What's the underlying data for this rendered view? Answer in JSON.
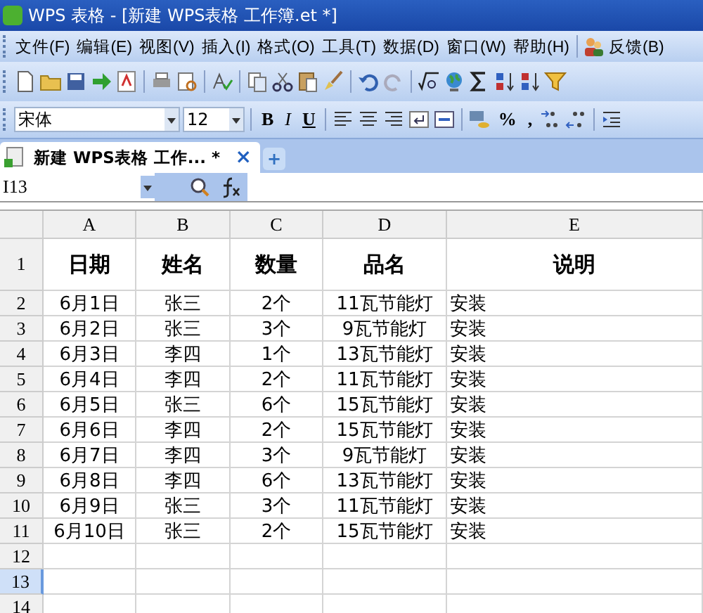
{
  "window": {
    "title": "WPS 表格 - [新建 WPS表格 工作簿.et *]"
  },
  "menu": [
    "文件(F)",
    "编辑(E)",
    "视图(V)",
    "插入(I)",
    "格式(O)",
    "工具(T)",
    "数据(D)",
    "窗口(W)",
    "帮助(H)"
  ],
  "feedback": "反馈(B)",
  "format_bar": {
    "font": "宋体",
    "size": "12",
    "bold": "B",
    "italic": "I",
    "underline": "U",
    "percent": "%",
    "comma": ","
  },
  "doc_tab": {
    "label": "新建 WPS表格 工作... *",
    "close": "×",
    "new": "+"
  },
  "name_box": "I13",
  "columns": [
    "A",
    "B",
    "C",
    "D",
    "E"
  ],
  "rows": [
    {
      "number": "1",
      "selected": false,
      "kind": "header",
      "cells": [
        "日期",
        "姓名",
        "数量",
        "品名",
        "说明"
      ]
    },
    {
      "number": "2",
      "selected": false,
      "kind": "data",
      "cells": [
        "6月1日",
        "张三",
        "2个",
        "11瓦节能灯",
        "安装"
      ]
    },
    {
      "number": "3",
      "selected": false,
      "kind": "data",
      "cells": [
        "6月2日",
        "张三",
        "3个",
        "9瓦节能灯",
        "安装"
      ]
    },
    {
      "number": "4",
      "selected": false,
      "kind": "data",
      "cells": [
        "6月3日",
        "李四",
        "1个",
        "13瓦节能灯",
        "安装"
      ]
    },
    {
      "number": "5",
      "selected": false,
      "kind": "data",
      "cells": [
        "6月4日",
        "李四",
        "2个",
        "11瓦节能灯",
        "安装"
      ]
    },
    {
      "number": "6",
      "selected": false,
      "kind": "data",
      "cells": [
        "6月5日",
        "张三",
        "6个",
        "15瓦节能灯",
        "安装"
      ]
    },
    {
      "number": "7",
      "selected": false,
      "kind": "data",
      "cells": [
        "6月6日",
        "李四",
        "2个",
        "15瓦节能灯",
        "安装"
      ]
    },
    {
      "number": "8",
      "selected": false,
      "kind": "data",
      "cells": [
        "6月7日",
        "李四",
        "3个",
        "9瓦节能灯",
        "安装"
      ]
    },
    {
      "number": "9",
      "selected": false,
      "kind": "data",
      "cells": [
        "6月8日",
        "李四",
        "6个",
        "13瓦节能灯",
        "安装"
      ]
    },
    {
      "number": "10",
      "selected": false,
      "kind": "data",
      "cells": [
        "6月9日",
        "张三",
        "3个",
        "11瓦节能灯",
        "安装"
      ]
    },
    {
      "number": "11",
      "selected": false,
      "kind": "data",
      "cells": [
        "6月10日",
        "张三",
        "2个",
        "15瓦节能灯",
        "安装"
      ]
    },
    {
      "number": "12",
      "selected": false,
      "kind": "data",
      "cells": [
        "",
        "",
        "",
        "",
        ""
      ]
    },
    {
      "number": "13",
      "selected": true,
      "kind": "data",
      "cells": [
        "",
        "",
        "",
        "",
        ""
      ]
    },
    {
      "number": "14",
      "selected": false,
      "kind": "data",
      "cells": [
        "",
        "",
        "",
        "",
        ""
      ]
    }
  ]
}
